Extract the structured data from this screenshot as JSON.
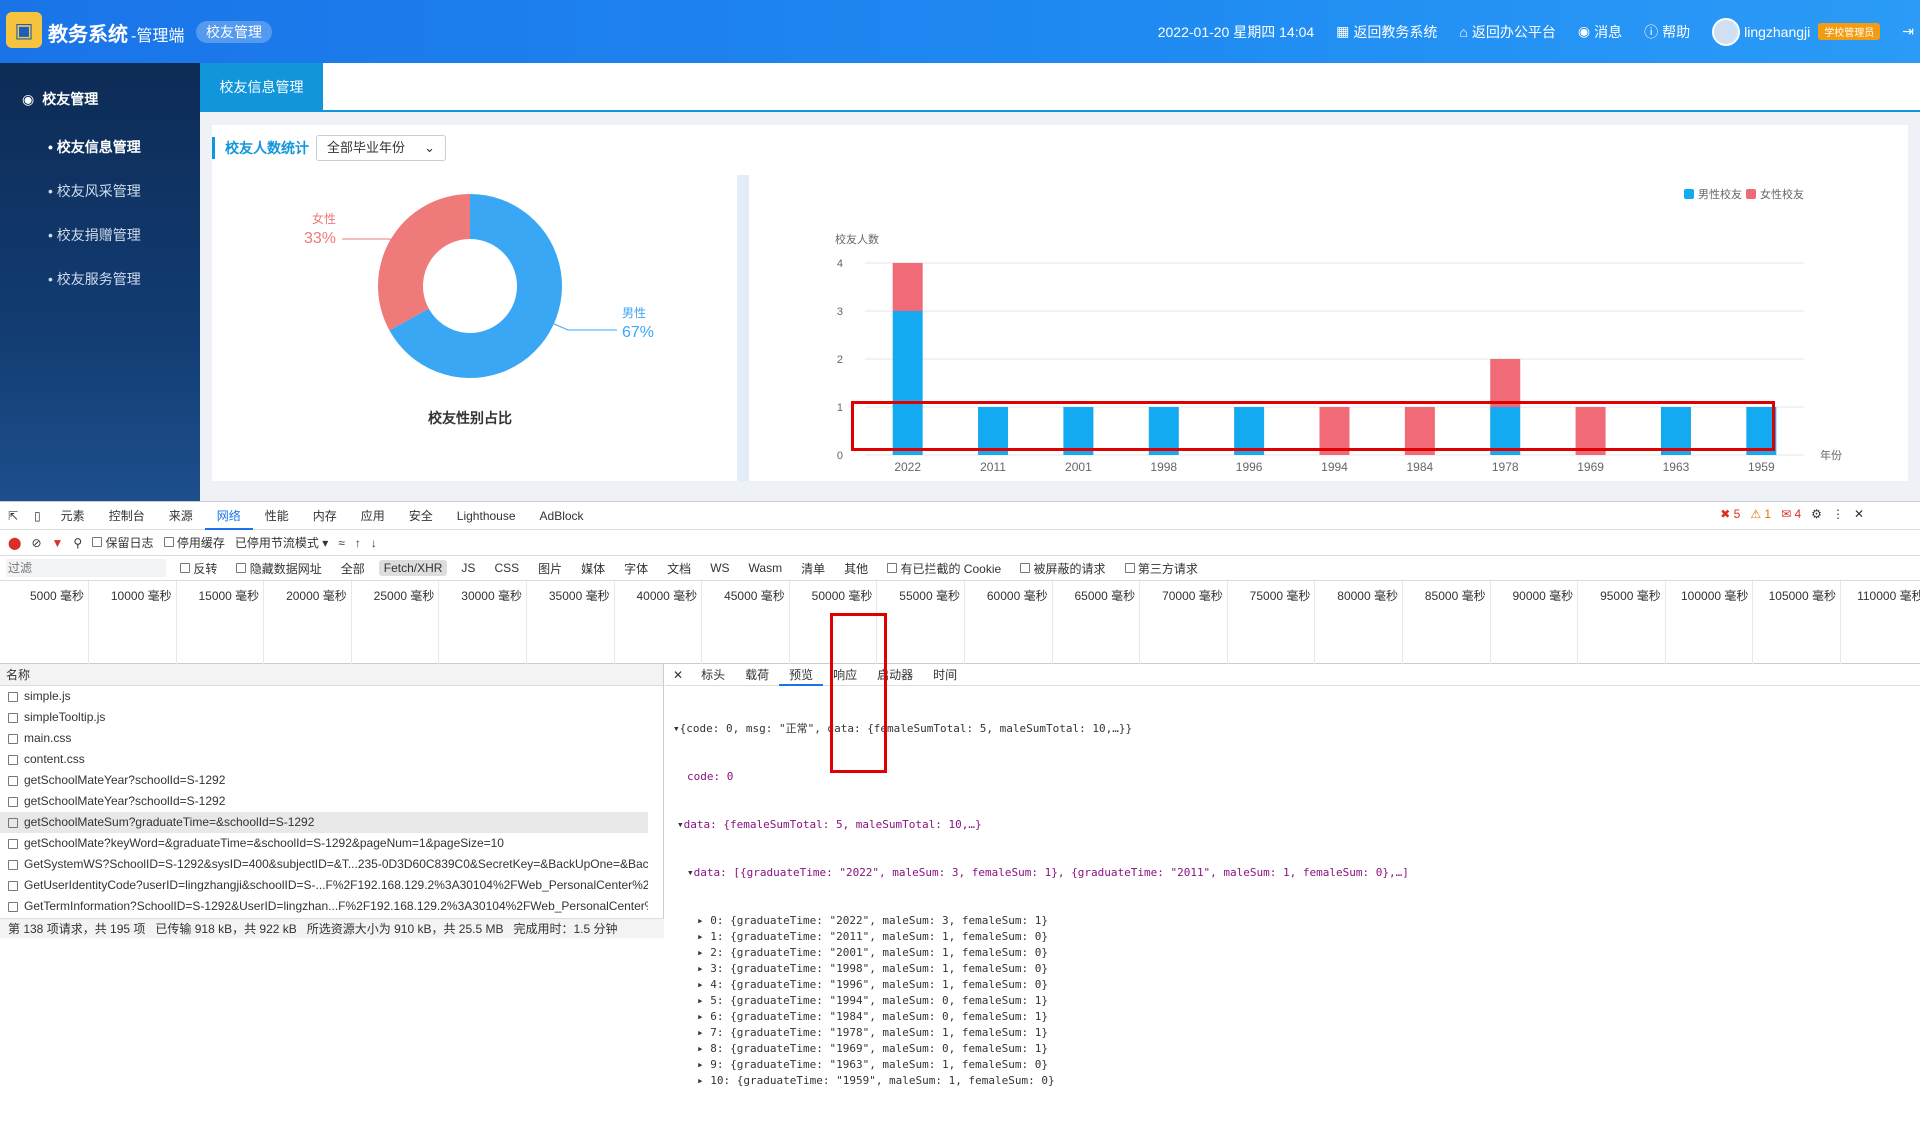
{
  "header": {
    "app_title": "教务系统",
    "app_sub": "-管理端",
    "module": "校友管理",
    "datetime": "2022-01-20 星期四 14:04",
    "links": [
      "返回教务系统",
      "返回办公平台",
      "消息",
      "帮助"
    ],
    "username": "lingzhangji",
    "role": "学校管理员"
  },
  "sidebar": {
    "title": "校友管理",
    "items": [
      "校友信息管理",
      "校友风采管理",
      "校友捐赠管理",
      "校友服务管理"
    ]
  },
  "tab": "校友信息管理",
  "card": {
    "title": "校友人数统计",
    "select_value": "全部毕业年份"
  },
  "pie": {
    "title": "校友性别占比",
    "male_label": "男性",
    "male_pct": "67%",
    "female_label": "女性",
    "female_pct": "33%",
    "male_value": 67,
    "female_value": 33,
    "male_color": "#3aa7f5",
    "female_color": "#ef7a7a"
  },
  "chart_data": {
    "type": "bar",
    "stacked": true,
    "categories": [
      "2022",
      "2011",
      "2001",
      "1998",
      "1996",
      "1994",
      "1984",
      "1978",
      "1969",
      "1963",
      "1959"
    ],
    "series": [
      {
        "name": "男性校友",
        "values": [
          3,
          1,
          1,
          1,
          1,
          0,
          0,
          1,
          0,
          1,
          1
        ],
        "color": "#13aaf2"
      },
      {
        "name": "女性校友",
        "values": [
          1,
          0,
          0,
          0,
          0,
          1,
          1,
          1,
          1,
          0,
          0
        ],
        "color": "#f06a78"
      }
    ],
    "ylabel": "校友人数",
    "xlabel": "年份",
    "ylim": [
      0,
      4
    ],
    "yticks": [
      0,
      1,
      2,
      3,
      4
    ],
    "legend": "top-right"
  },
  "devtools": {
    "tabs": [
      "元素",
      "控制台",
      "来源",
      "网络",
      "性能",
      "内存",
      "应用",
      "安全",
      "Lighthouse",
      "AdBlock"
    ],
    "active_tab": "网络",
    "errors": "5",
    "warnings": "1",
    "issues": "4",
    "toolbar": [
      "保留日志",
      "停用缓存",
      "已停用节流模式"
    ],
    "filter_placeholder": "过滤",
    "filter_items": [
      "反转",
      "隐藏数据网址",
      "全部",
      "Fetch/XHR",
      "JS",
      "CSS",
      "图片",
      "媒体",
      "字体",
      "文档",
      "WS",
      "Wasm",
      "清单",
      "其他",
      "有已拦截的 Cookie",
      "被屏蔽的请求",
      "第三方请求"
    ],
    "ticks": [
      "5000 毫秒",
      "10000 毫秒",
      "15000 毫秒",
      "20000 毫秒",
      "25000 毫秒",
      "30000 毫秒",
      "35000 毫秒",
      "40000 毫秒",
      "45000 毫秒",
      "50000 毫秒",
      "55000 毫秒",
      "60000 毫秒",
      "65000 毫秒",
      "70000 毫秒",
      "75000 毫秒",
      "80000 毫秒",
      "85000 毫秒",
      "90000 毫秒",
      "95000 毫秒",
      "100000 毫秒",
      "105000 毫秒",
      "110000 毫秒"
    ],
    "names_header": "名称",
    "requests": [
      "simple.js",
      "simpleTooltip.js",
      "main.css",
      "content.css",
      "getSchoolMateYear?schoolId=S-1292",
      "getSchoolMateYear?schoolId=S-1292",
      "getSchoolMateSum?graduateTime=&schoolId=S-1292",
      "getSchoolMate?keyWord=&graduateTime=&schoolId=S-1292&pageNum=1&pageSize=10",
      "GetSystemWS?SchoolID=S-1292&sysID=400&subjectID=&T...235-0D3D60C839C0&SecretKey=&BackUpOne=&Back...",
      "GetUserIdentityCode?userID=lingzhangji&schoolID=S-...F%2F192.168.129.2%3A30104%2FWeb_PersonalCenter%2F",
      "GetTermInformation?SchoolID=S-1292&UserID=lingzhan...F%2F192.168.129.2%3A30104%2FWeb_PersonalCenter%2F"
    ],
    "status": [
      "第 138 项请求，共 195 项",
      "已传输 918 kB，共 922 kB",
      "所选资源大小为 910 kB，共 25.5 MB",
      "完成用时：1.5 分钟"
    ],
    "preview_tabs": [
      "标头",
      "载荷",
      "预览",
      "响应",
      "启动器",
      "时间"
    ],
    "json_summary": "{code: 0, msg: \"正常\", data: {femaleSumTotal: 5, maleSumTotal: 10,…}}",
    "json_code": "code: 0",
    "json_data": "data: {femaleSumTotal: 5, maleSumTotal: 10,…}",
    "json_data_arr": "data: [{graduateTime: \"2022\", maleSum: 3, femaleSum: 1}, {graduateTime: \"2011\", maleSum: 1, femaleSum: 0},…]",
    "json_rows": [
      "0: {graduateTime: \"2022\", maleSum: 3, femaleSum: 1}",
      "1: {graduateTime: \"2011\", maleSum: 1, femaleSum: 0}",
      "2: {graduateTime: \"2001\", maleSum: 1, femaleSum: 0}",
      "3: {graduateTime: \"1998\", maleSum: 1, femaleSum: 0}",
      "4: {graduateTime: \"1996\", maleSum: 1, femaleSum: 0}",
      "5: {graduateTime: \"1994\", maleSum: 0, femaleSum: 1}",
      "6: {graduateTime: \"1984\", maleSum: 0, femaleSum: 1}",
      "7: {graduateTime: \"1978\", maleSum: 1, femaleSum: 1}",
      "8: {graduateTime: \"1969\", maleSum: 0, femaleSum: 1}",
      "9: {graduateTime: \"1963\", maleSum: 1, femaleSum: 0}",
      "10: {graduateTime: \"1959\", maleSum: 1, femaleSum: 0}"
    ]
  }
}
